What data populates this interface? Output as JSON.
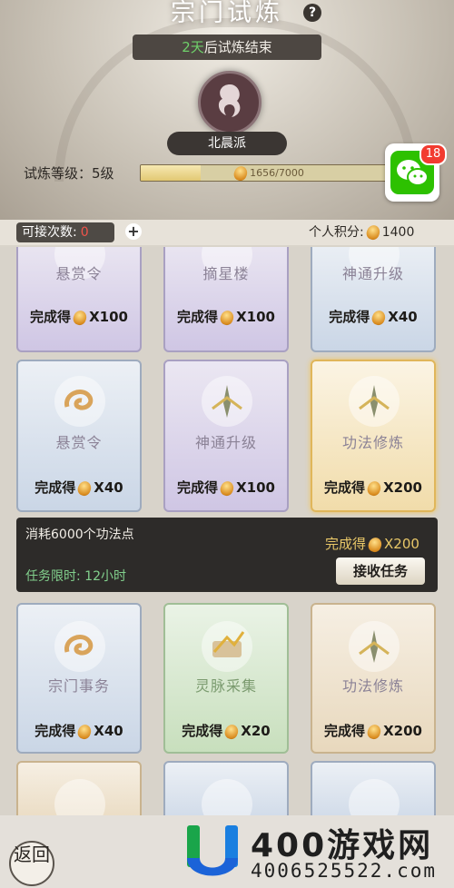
{
  "header": {
    "title": "宗门试炼",
    "help_symbol": "?",
    "countdown_value": "2天",
    "countdown_suffix": "后试炼结束",
    "sect_name": "北晨派",
    "level_label": "试炼等级：5级",
    "level_progress_text": "1656/7000",
    "level_progress_fraction": 0.237
  },
  "notification": {
    "app": "wechat",
    "badge": "18",
    "color": "#2dc100"
  },
  "status": {
    "accept_label": "可接次数:",
    "accept_count": "0",
    "plus_symbol": "+",
    "points_label": "个人积分:",
    "points_value": "1400"
  },
  "cards": [
    {
      "name": "悬赏令",
      "reward_label": "完成得",
      "reward": "X100",
      "theme": "purple",
      "icon": "swirl-cloud-icon"
    },
    {
      "name": "摘星楼",
      "reward_label": "完成得",
      "reward": "X100",
      "theme": "purple",
      "icon": "swirl-cloud-icon"
    },
    {
      "name": "神通升级",
      "reward_label": "完成得",
      "reward": "X40",
      "theme": "blue",
      "icon": "spirit-tree-icon"
    },
    {
      "name": "悬赏令",
      "reward_label": "完成得",
      "reward": "X40",
      "theme": "blue",
      "icon": "swirl-cloud-icon"
    },
    {
      "name": "神通升级",
      "reward_label": "完成得",
      "reward": "X100",
      "theme": "purple",
      "icon": "spirit-tree-icon"
    },
    {
      "name": "功法修炼",
      "reward_label": "完成得",
      "reward": "X200",
      "theme": "gold",
      "icon": "spirit-tree-icon"
    },
    {
      "name": "宗门事务",
      "reward_label": "完成得",
      "reward": "X40",
      "theme": "blue",
      "icon": "swirl-cloud-icon"
    },
    {
      "name": "灵脉采集",
      "reward_label": "完成得",
      "reward": "X20",
      "theme": "green",
      "icon": "scroll-arrow-icon"
    },
    {
      "name": "功法修炼",
      "reward_label": "完成得",
      "reward": "X200",
      "theme": "peach",
      "icon": "spirit-tree-icon"
    },
    {
      "name": "",
      "reward_label": "",
      "reward": "",
      "theme": "peach",
      "icon": "swirl-cloud-icon"
    },
    {
      "name": "",
      "reward_label": "",
      "reward": "",
      "theme": "blue",
      "icon": "spirit-tree-icon"
    },
    {
      "name": "",
      "reward_label": "",
      "reward": "",
      "theme": "blue",
      "icon": "swirl-cloud-icon"
    }
  ],
  "detail": {
    "cost": "消耗6000个功法点",
    "reward_label": "完成得",
    "reward": "X200",
    "limit": "任务限时: 12小时",
    "accept_button": "接收任务"
  },
  "footer": {
    "back_label": "返回",
    "watermark_name": "400游戏网",
    "watermark_phone": "4006525522.com"
  }
}
